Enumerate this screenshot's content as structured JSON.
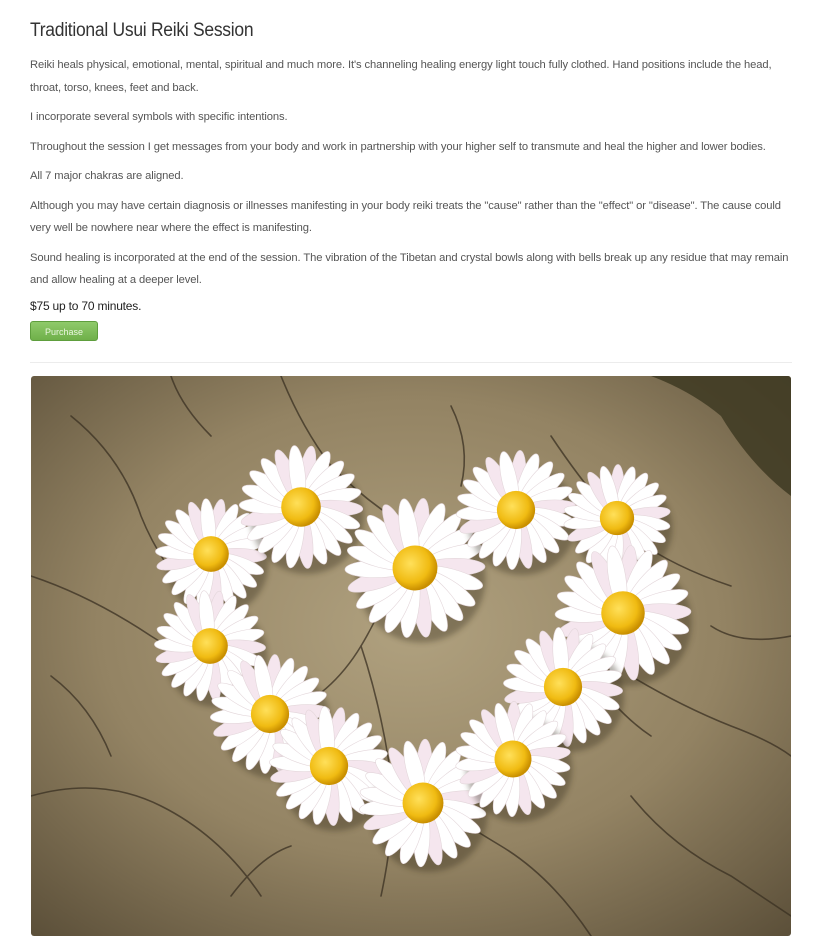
{
  "session": {
    "title": "Traditional Usui Reiki Session",
    "paragraphs": [
      "Reiki heals physical, emotional, mental, spiritual and much more. It's channeling healing energy light touch fully clothed. Hand positions include the head, throat, torso, knees, feet and back.",
      "I incorporate several symbols with specific intentions.",
      "Throughout the session I get messages from your body and work in partnership with your higher self to transmute and heal the higher and lower bodies.",
      "All 7 major chakras are aligned.",
      "Although you may have certain diagnosis or illnesses manifesting in your body reiki treats the \"cause\" rather than the \"effect\" or \"disease\". The cause could very well be nowhere near where the effect is manifesting.",
      "Sound healing is incorporated at the end of the session. The vibration of the Tibetan and crystal bowls along with bells break up any residue that may remain and allow healing at a deeper level."
    ],
    "price": "$75 up to 70 minutes.",
    "purchase_label": "Purchase"
  },
  "image": {
    "subject": "daisies arranged in a heart shape on a cracked wooden tree stump",
    "colors": {
      "wood": "#8a7a5e",
      "petal": "#ffffff",
      "center": "#f2c21b"
    }
  }
}
